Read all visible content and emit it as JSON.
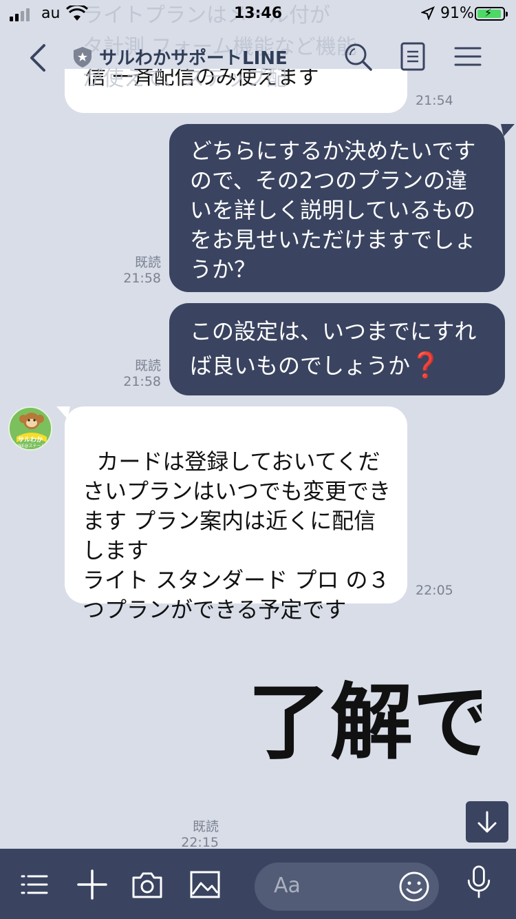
{
  "status": {
    "carrier": "au",
    "time": "13:46",
    "battery": "91%"
  },
  "header": {
    "title": "サルわかサポートLINE",
    "icons": [
      "back-chevron-icon",
      "shield-badge-icon",
      "search-icon",
      "notes-icon",
      "menu-icon"
    ]
  },
  "partial_message": {
    "lines": [
      "ライトプランはメール付が",
      "タ計測 フォーム機能など機能",
      "が使えて、ステップ配",
      "信 一斉配信のみ使えます"
    ],
    "time": "21:54"
  },
  "messages": [
    {
      "dir": "out",
      "text": "どちらにするか決めたいですので、その2つのプランの違いを詳しく説明しているものをお見せいただけますでしょうか？",
      "read": "既読",
      "time": "21:58"
    },
    {
      "dir": "out",
      "text": "この設定は、いつまでにすれば良いものでしょうか",
      "emoji": "❓",
      "read": "既読",
      "time": "21:58"
    },
    {
      "dir": "in",
      "text": "カードは登録しておいてくださいプランはいつでも変更できます プラン案内は近くに配信します\nライト スタンダード プロ の３つプランができる予定です",
      "time": "22:05"
    }
  ],
  "avatar": {
    "label_top": "サルわか",
    "label_bottom": "LINE@ステーム"
  },
  "sticker": {
    "text": "了解です",
    "read": "既読",
    "time": "22:15"
  },
  "input": {
    "placeholder": "Aa"
  },
  "bottom_icons": [
    "menu-list-icon",
    "plus-icon",
    "camera-icon",
    "image-icon",
    "emoji-icon",
    "microphone-icon"
  ],
  "colors": {
    "background": "#d8dde8",
    "outgoing_bubble": "#3a4460",
    "incoming_bubble": "#ffffff",
    "bar": "#3a4460"
  }
}
